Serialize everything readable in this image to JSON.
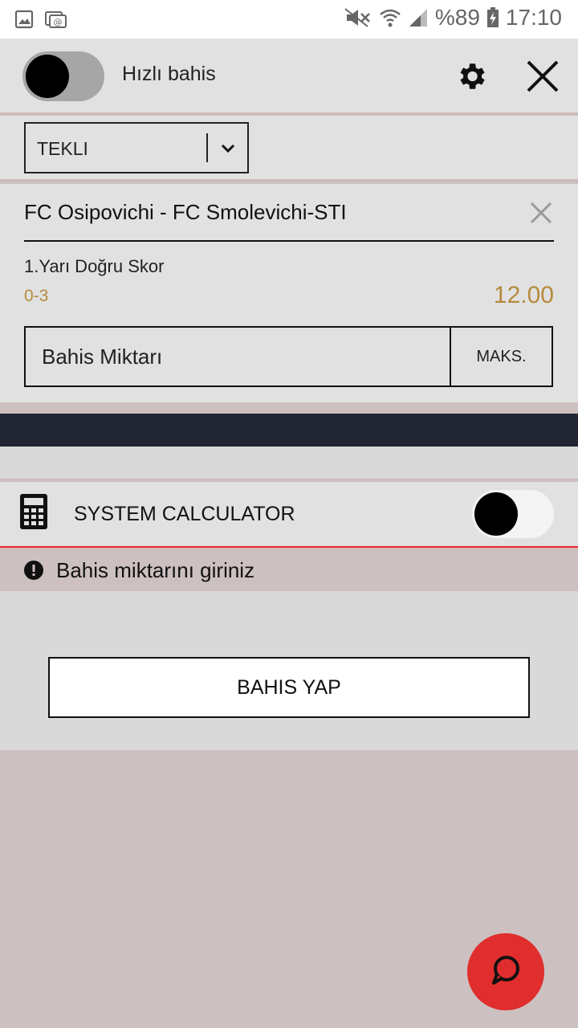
{
  "status_bar": {
    "battery": "%89",
    "time": "17:10"
  },
  "header": {
    "quick_bet_label": "Hızlı bahis"
  },
  "bet_type": {
    "selected": "TEKLI"
  },
  "bet": {
    "match": "FC Osipovichi - FC Smolevichi-STI",
    "market": "1.Yarı Doğru Skor",
    "selection": "0-3",
    "odds": "12.00",
    "stake_placeholder": "Bahis Miktarı",
    "max_label": "MAKS."
  },
  "system_calculator": {
    "label": "SYSTEM CALCULATOR"
  },
  "warning": {
    "text": "Bahis miktarını giriniz"
  },
  "place_bet": {
    "label": "BAHIS YAP"
  },
  "colors": {
    "odds": "#b58a3c",
    "fab": "#e02d2d",
    "dark_band": "#222633",
    "warning_line": "#ee2222"
  }
}
